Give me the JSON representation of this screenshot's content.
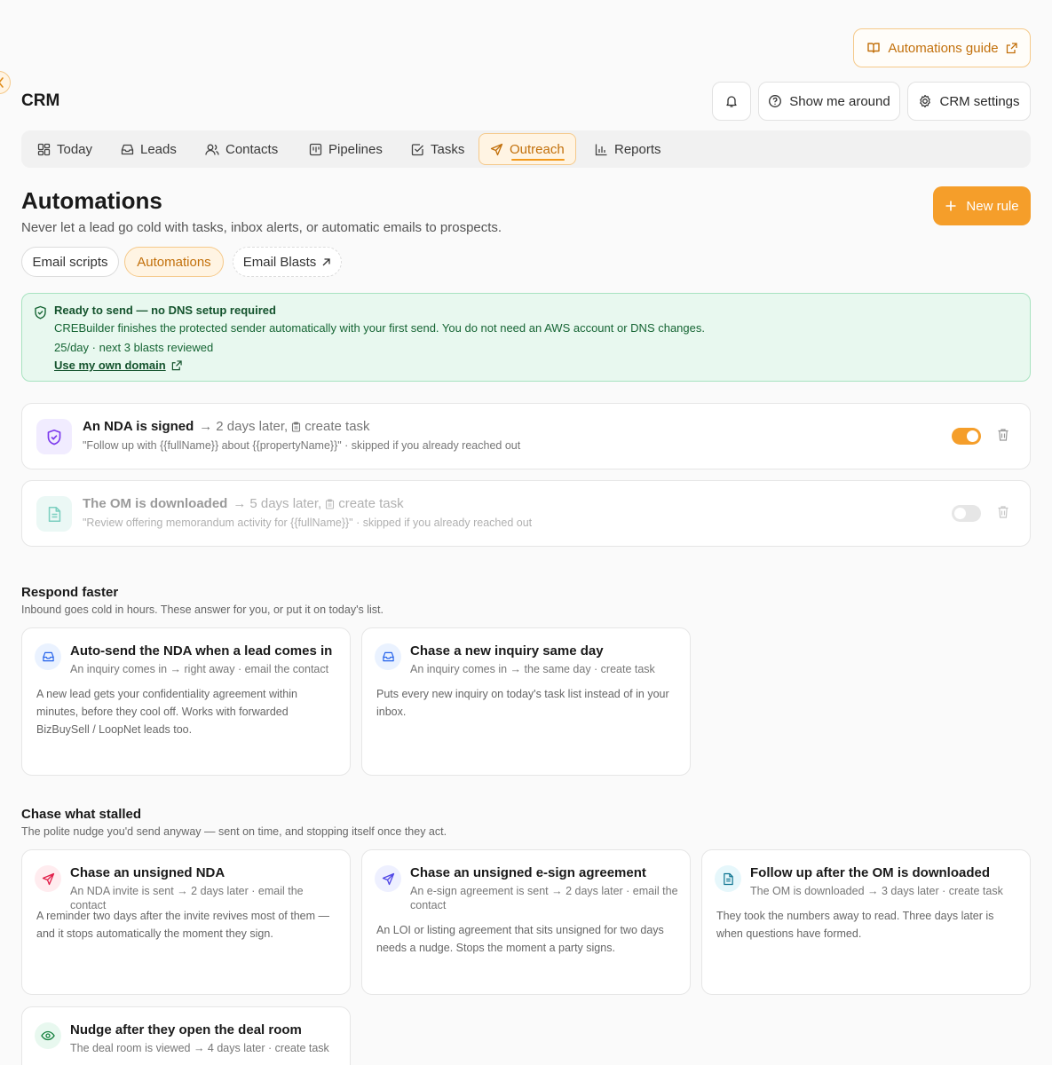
{
  "header": {
    "guide_label": "Automations guide",
    "app_title": "CRM",
    "show_around_label": "Show me around",
    "settings_label": "CRM settings"
  },
  "tabs": [
    {
      "label": "Today",
      "icon": "grid-icon"
    },
    {
      "label": "Leads",
      "icon": "inbox-icon"
    },
    {
      "label": "Contacts",
      "icon": "users-icon"
    },
    {
      "label": "Pipelines",
      "icon": "kanban-icon"
    },
    {
      "label": "Tasks",
      "icon": "checkbox-icon"
    },
    {
      "label": "Outreach",
      "icon": "send-icon",
      "active": true
    },
    {
      "label": "Reports",
      "icon": "bar-chart-icon"
    }
  ],
  "page": {
    "title": "Automations",
    "subtitle": "Never let a lead go cold with tasks, inbox alerts, or automatic emails to prospects.",
    "new_rule_label": "New rule"
  },
  "subtabs": [
    {
      "label": "Email scripts"
    },
    {
      "label": "Automations",
      "active": true
    },
    {
      "label": "Email Blasts"
    }
  ],
  "notice": {
    "title": "Ready to send — no DNS setup required",
    "body": "CREBuilder finishes the protected sender automatically with your first send. You do not need an AWS account or DNS changes.",
    "quota": "25/day · next 3 blasts reviewed",
    "link": "Use my own domain"
  },
  "rules": [
    {
      "trigger": "An NDA is signed",
      "delay": "2 days later,",
      "action": "create task",
      "note": "\"Follow up with {{fullName}} about {{propertyName}}\" · skipped if you already reached out",
      "enabled": true
    },
    {
      "trigger": "The OM is downloaded",
      "delay": "5 days later,",
      "action": "create task",
      "note": "\"Review offering memorandum activity for {{fullName}}\" · skipped if you already reached out",
      "enabled": false
    }
  ],
  "respond": {
    "title": "Respond faster",
    "subtitle": "Inbound goes cold in hours. These answer for you, or put it on today's list.",
    "cards": [
      {
        "title": "Auto-send the NDA when a lead comes in",
        "meta": "An inquiry comes in → right away · email the contact",
        "desc": "A new lead gets your confidentiality agreement within minutes, before they cool off. Works with forwarded BizBuySell / LoopNet leads too."
      },
      {
        "title": "Chase a new inquiry same day",
        "meta": "An inquiry comes in → the same day · create task",
        "desc": "Puts every new inquiry on today's task list instead of in your inbox."
      }
    ]
  },
  "stalled": {
    "title": "Chase what stalled",
    "subtitle": "The polite nudge you'd send anyway — sent on time, and stopping itself once they act.",
    "cards": [
      {
        "title": "Chase an unsigned NDA",
        "meta": "An NDA invite is sent → 2 days later · email the contact",
        "desc": "A reminder two days after the invite revives most of them — and it stops automatically the moment they sign."
      },
      {
        "title": "Chase an unsigned e-sign agreement",
        "meta": "An e-sign agreement is sent → 2 days later · email the contact",
        "desc": "An LOI or listing agreement that sits unsigned for two days needs a nudge. Stops the moment a party signs."
      },
      {
        "title": "Follow up after the OM is downloaded",
        "meta": "The OM is downloaded → 3 days later · create task",
        "desc": "They took the numbers away to read. Three days later is when questions have formed."
      },
      {
        "title": "Nudge after they open the deal room",
        "meta": "The deal room is viewed → 4 days later · create task",
        "desc": ""
      }
    ]
  },
  "colors": {
    "accent": "#f59e2a",
    "accent_text": "#c2700b",
    "success_bg": "#e8f8ef"
  }
}
